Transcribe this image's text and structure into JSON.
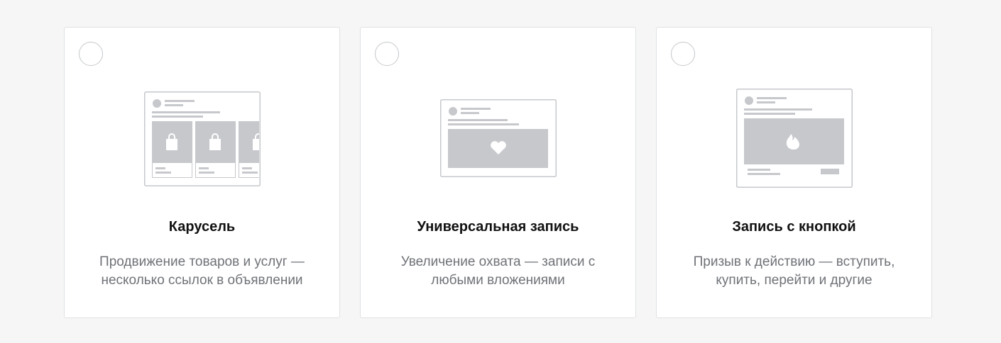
{
  "cards": [
    {
      "title": "Карусель",
      "description": "Продвижение товаров и услуг —\nнесколько ссылок в объявлении",
      "illustration_icon": "shopping-bag-icon"
    },
    {
      "title": "Универсальная запись",
      "description": "Увеличение охвата — записи с\nлюбыми вложениями",
      "illustration_icon": "heart-icon"
    },
    {
      "title": "Запись с кнопкой",
      "description": "Призыв к действию — вступить,\nкупить, перейти и другие",
      "illustration_icon": "flame-icon"
    }
  ],
  "colors": {
    "page_background": "#f6f6f6",
    "card_border": "#dfe1e4",
    "placeholder_gray": "#c6c8cc",
    "description_text": "#6f7277"
  }
}
